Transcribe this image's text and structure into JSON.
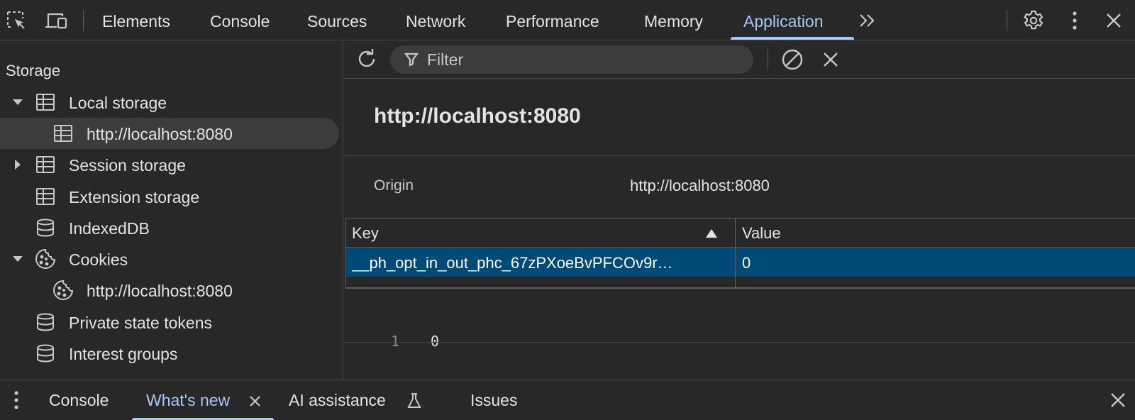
{
  "toolbar": {
    "tabs": [
      "Elements",
      "Console",
      "Sources",
      "Network",
      "Performance",
      "Memory",
      "Application"
    ],
    "active_tab": "Application",
    "icons": [
      "element-picker-icon",
      "device-toggle-icon",
      "more-tabs-icon",
      "settings-icon",
      "kebab-menu-icon",
      "close-icon"
    ]
  },
  "sidebar": {
    "header": "Storage",
    "items": [
      {
        "label": "Local storage",
        "icon": "table-icon",
        "expanded": true
      },
      {
        "label": "http://localhost:8080",
        "icon": "table-icon",
        "selected": true
      },
      {
        "label": "Session storage",
        "icon": "table-icon",
        "expanded": false
      },
      {
        "label": "Extension storage",
        "icon": "table-icon"
      },
      {
        "label": "IndexedDB",
        "icon": "database-icon"
      },
      {
        "label": "Cookies",
        "icon": "cookie-icon",
        "expanded": true
      },
      {
        "label": "http://localhost:8080",
        "icon": "cookie-icon"
      },
      {
        "label": "Private state tokens",
        "icon": "database-icon"
      },
      {
        "label": "Interest groups",
        "icon": "database-icon"
      }
    ]
  },
  "main": {
    "filter_placeholder": "Filter",
    "origin_title": "http://localhost:8080",
    "origin_label": "Origin",
    "origin_value": "http://localhost:8080",
    "table": {
      "columns": [
        "Key",
        "Value"
      ],
      "sort_column": "Key",
      "rows": [
        {
          "key": "__ph_opt_in_out_phc_67zPXoeBvPFCOv9r…",
          "value": "0",
          "selected": true
        }
      ]
    },
    "preview": {
      "line_number": "1",
      "text": "0"
    }
  },
  "drawer": {
    "tabs": [
      {
        "label": "Console"
      },
      {
        "label": "What's new",
        "active": true,
        "closable": true
      },
      {
        "label": "AI assistance",
        "icon": "flask-icon"
      },
      {
        "label": "Issues"
      }
    ]
  },
  "colors": {
    "accent": "#a8c7fa",
    "selected_row": "#004a77",
    "background": "#282828"
  }
}
